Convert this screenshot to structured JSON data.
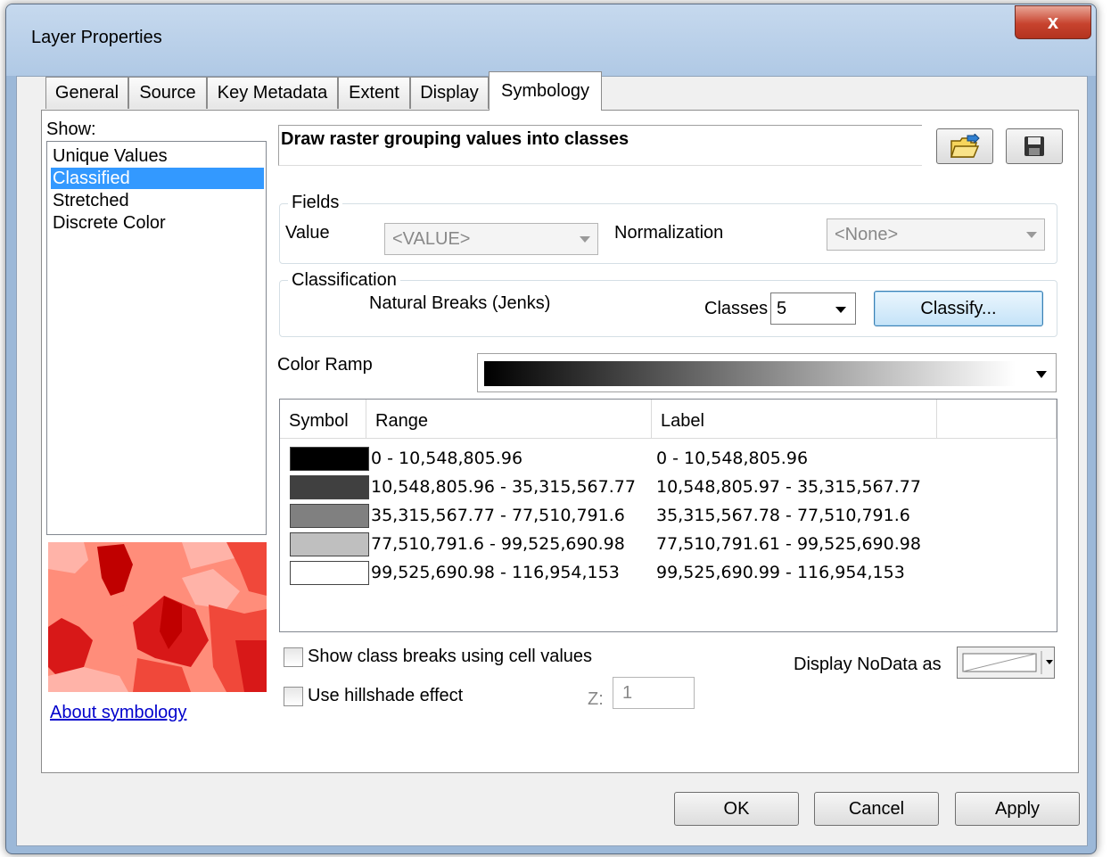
{
  "window": {
    "title": "Layer Properties",
    "close_glyph": "x"
  },
  "tabs": [
    {
      "label": "General"
    },
    {
      "label": "Source"
    },
    {
      "label": "Key Metadata"
    },
    {
      "label": "Extent"
    },
    {
      "label": "Display"
    },
    {
      "label": "Symbology",
      "active": true
    }
  ],
  "show": {
    "label": "Show:",
    "items": [
      "Unique Values",
      "Classified",
      "Stretched",
      "Discrete Color"
    ],
    "selected": "Classified"
  },
  "about_link": "About symbology",
  "description": "Draw raster grouping values into classes",
  "fields": {
    "title": "Fields",
    "value_label": "Value",
    "value_selected": "<VALUE>",
    "normalization_label": "Normalization",
    "normalization_selected": "<None>"
  },
  "classification": {
    "title": "Classification",
    "method": "Natural Breaks (Jenks)",
    "classes_label": "Classes",
    "classes_value": "5",
    "classify_button": "Classify..."
  },
  "color_ramp": {
    "label": "Color Ramp",
    "start_color": "#000000",
    "end_color": "#ffffff"
  },
  "table": {
    "headers": [
      "Symbol",
      "Range",
      "Label"
    ],
    "rows": [
      {
        "color": "#000000",
        "range": "0 - 10,548,805.96",
        "label": "0 - 10,548,805.96"
      },
      {
        "color": "#404040",
        "range": "10,548,805.96 - 35,315,567.77",
        "label": "10,548,805.97 - 35,315,567.77"
      },
      {
        "color": "#808080",
        "range": "35,315,567.77 - 77,510,791.6",
        "label": "35,315,567.78 - 77,510,791.6"
      },
      {
        "color": "#bfbfbf",
        "range": "77,510,791.6 - 99,525,690.98",
        "label": "77,510,791.61 - 99,525,690.98"
      },
      {
        "color": "#ffffff",
        "range": "99,525,690.98 - 116,954,153",
        "label": "99,525,690.99 - 116,954,153"
      }
    ]
  },
  "options": {
    "show_class_breaks": "Show class breaks using cell values",
    "use_hillshade": "Use hillshade effect",
    "z_label": "Z:",
    "z_value": "1",
    "display_nodata_label": "Display NoData as"
  },
  "buttons": {
    "ok": "OK",
    "cancel": "Cancel",
    "apply": "Apply"
  },
  "preview": {
    "palette": [
      "#ff8d7a",
      "#ffb3a8",
      "#f0483a",
      "#d81818",
      "#c00000"
    ]
  }
}
